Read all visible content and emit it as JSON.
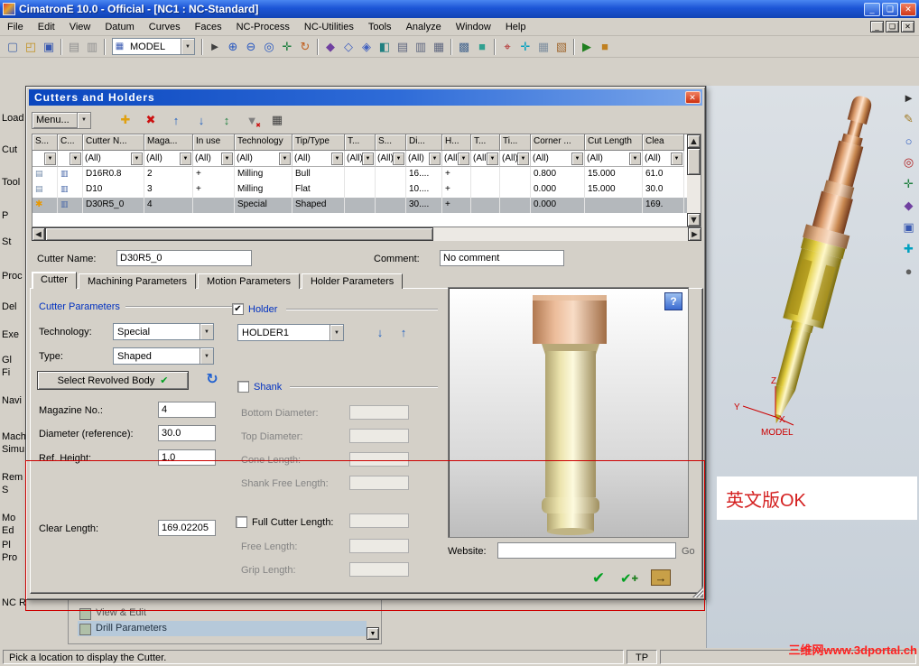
{
  "window": {
    "title": "CimatronE 10.0 - Official - [NC1 : NC-Standard]",
    "controls": {
      "minimize": "_",
      "restore": "❏",
      "close": "✕"
    }
  },
  "menu_bar": [
    "File",
    "Edit",
    "View",
    "Datum",
    "Curves",
    "Faces",
    "NC-Process",
    "NC-Utilities",
    "Tools",
    "Analyze",
    "Window",
    "Help"
  ],
  "mdi_controls": {
    "minimize": "_",
    "restore": "❏",
    "close": "✕"
  },
  "main_toolbar": {
    "model_selector": "MODEL",
    "icons_left": [
      {
        "name": "new-file-icon",
        "glyph": "▢",
        "color": "#4868a8"
      },
      {
        "name": "open-file-icon",
        "glyph": "◰",
        "color": "#c09020"
      },
      {
        "name": "save-icon",
        "glyph": "▣",
        "color": "#3858b0"
      },
      {
        "sep": true
      },
      {
        "name": "print-icon",
        "glyph": "▤",
        "color": "#909090"
      },
      {
        "name": "print-preview-icon",
        "glyph": "▥",
        "color": "#909090"
      },
      {
        "sep": true
      }
    ],
    "icons_right": [
      {
        "sep": true
      },
      {
        "name": "select-icon",
        "glyph": "►",
        "color": "#404040"
      },
      {
        "name": "zoom-in-icon",
        "glyph": "⊕",
        "color": "#2858c0"
      },
      {
        "name": "zoom-out-icon",
        "glyph": "⊖",
        "color": "#2858c0"
      },
      {
        "name": "zoom-fit-icon",
        "glyph": "◎",
        "color": "#2858c0"
      },
      {
        "name": "pan-icon",
        "glyph": "✛",
        "color": "#208040"
      },
      {
        "name": "rotate-view-icon",
        "glyph": "↻",
        "color": "#c06020"
      },
      {
        "sep": true
      },
      {
        "name": "shaded-view-icon",
        "glyph": "◆",
        "color": "#7040a0"
      },
      {
        "name": "wireframe-view-icon",
        "glyph": "◇",
        "color": "#4060c0"
      },
      {
        "name": "hidden-line-icon",
        "glyph": "◈",
        "color": "#4060c0"
      },
      {
        "name": "iso-view-icon",
        "glyph": "◧",
        "color": "#208080"
      },
      {
        "name": "top-view-icon",
        "glyph": "▤",
        "color": "#606880"
      },
      {
        "name": "front-view-icon",
        "glyph": "▥",
        "color": "#606880"
      },
      {
        "name": "right-view-icon",
        "glyph": "▦",
        "color": "#606880"
      },
      {
        "sep": true
      },
      {
        "name": "display-mode-icon",
        "glyph": "▩",
        "color": "#486890"
      },
      {
        "name": "render-icon",
        "glyph": "■",
        "color": "#30a090"
      },
      {
        "sep": true
      },
      {
        "name": "measure-icon",
        "glyph": "⌖",
        "color": "#b02020"
      },
      {
        "name": "ucs-icon",
        "glyph": "✛",
        "color": "#00a0c0"
      },
      {
        "name": "grid-icon",
        "glyph": "▦",
        "color": "#8090a0"
      },
      {
        "name": "layers-icon",
        "glyph": "▧",
        "color": "#a06830"
      },
      {
        "sep": true
      },
      {
        "name": "simulate-icon",
        "glyph": "▶",
        "color": "#208020"
      },
      {
        "name": "stock-icon",
        "glyph": "■",
        "color": "#c08020"
      }
    ]
  },
  "secondary_toolbar": {
    "icons": [
      {
        "name": "datum-csys-icon",
        "glyph": "✛",
        "color": "#00a0c0"
      },
      {
        "name": "axis-icon",
        "glyph": "⌖",
        "color": "#b02020"
      },
      {
        "name": "plane-icon",
        "glyph": "◧",
        "color": "#4060c0"
      },
      {
        "name": "point-icon",
        "glyph": "●",
        "color": "#202020"
      },
      {
        "name": "corner-icon",
        "glyph": "∟",
        "color": "#208040"
      },
      {
        "name": "view-manager-icon",
        "glyph": "▦",
        "color": "#606880"
      },
      {
        "name": "snap-icon",
        "glyph": "◎",
        "color": "#a06830"
      }
    ]
  },
  "right_toolbar": {
    "icons": [
      {
        "name": "select-tool-icon",
        "glyph": "►",
        "color": "#303030"
      },
      {
        "name": "sketch-pencil-icon",
        "glyph": "✎",
        "color": "#a07820"
      },
      {
        "name": "circle-icon",
        "glyph": "○",
        "color": "#2858c0"
      },
      {
        "name": "target-icon",
        "glyph": "◎",
        "color": "#b02020"
      },
      {
        "name": "cross-icon",
        "glyph": "✛",
        "color": "#208040"
      },
      {
        "name": "diamond-icon",
        "glyph": "◆",
        "color": "#7040a0"
      },
      {
        "name": "solid-icon",
        "glyph": "▣",
        "color": "#3858b0"
      },
      {
        "name": "add-icon",
        "glyph": "✚",
        "color": "#00a0c0"
      },
      {
        "name": "dot-icon",
        "glyph": "●",
        "color": "#606060"
      }
    ]
  },
  "left_panel_labels": [
    "Load",
    "Cut",
    "Tool",
    "P",
    "St",
    "Proc",
    "Del",
    "Exe",
    "Gl",
    "Fi",
    "Navi",
    "Mach",
    "Simu",
    "Rem",
    "S",
    "Mo",
    "Ed",
    "Pl",
    "Pro",
    "NC Report"
  ],
  "dialog": {
    "title": "Cutters and Holders",
    "close_glyph": "✕",
    "menu_button": "Menu...",
    "toolbar_icons": [
      {
        "name": "add-cutter-icon",
        "glyph": "✚",
        "color": "#e0a010"
      },
      {
        "name": "delete-cutter-icon",
        "glyph": "✖",
        "color": "#cc1010"
      },
      {
        "name": "export-cutter-icon",
        "glyph": "↑",
        "color": "#2060c0"
      },
      {
        "name": "import-cutter-icon",
        "glyph": "↓",
        "color": "#2060c0"
      },
      {
        "name": "sync-cutter-icon",
        "glyph": "↕",
        "color": "#208040"
      },
      {
        "name": "clear-filter-icon",
        "glyph": "▼",
        "color": "#808080",
        "badge": "✖",
        "badge_color": "#cc1010"
      },
      {
        "name": "cutter-catalog-icon",
        "glyph": "▦",
        "color": "#404040"
      }
    ],
    "table": {
      "columns": [
        "S...",
        "C...",
        "Cutter N...",
        "Maga...",
        "In use",
        "Technology",
        "Tip/Type",
        "T...",
        "S...",
        "Di...",
        "H...",
        "T...",
        "Ti...",
        "Corner ...",
        "Cut Length",
        "Clea"
      ],
      "filters": [
        "",
        "",
        "(All)",
        "(All)",
        "(All)",
        "(All)",
        "(All)",
        "(All)",
        "(All)",
        "(All)",
        "(All)",
        "(All)",
        "(All)",
        "(All)",
        "(All)",
        "(All)"
      ],
      "rows": [
        {
          "current": false,
          "selected": false,
          "cells": [
            "",
            "",
            "D16R0.8",
            "2",
            "+",
            "Milling",
            "Bull",
            "",
            "",
            "16....",
            "+",
            "",
            "",
            "0.800",
            "15.000",
            "61.0"
          ]
        },
        {
          "current": false,
          "selected": false,
          "cells": [
            "",
            "",
            "D10",
            "3",
            "+",
            "Milling",
            "Flat",
            "",
            "",
            "10....",
            "+",
            "",
            "",
            "0.000",
            "15.000",
            "30.0"
          ]
        },
        {
          "current": true,
          "selected": true,
          "cells": [
            "",
            "",
            "D30R5_0",
            "4",
            "",
            "Special",
            "Shaped",
            "",
            "",
            "30....",
            "+",
            "",
            "",
            "0.000",
            "",
            "169."
          ]
        }
      ]
    },
    "tabs": [
      "Cutter",
      "Machining Parameters",
      "Motion Parameters",
      "Holder Parameters"
    ],
    "active_tab": 0,
    "form": {
      "cutter_name_label": "Cutter Name:",
      "cutter_name": "D30R5_0",
      "comment_label": "Comment:",
      "comment": "No comment",
      "cutter_parameters_title": "Cutter Parameters",
      "technology_label": "Technology:",
      "technology": "Special",
      "type_label": "Type:",
      "type": "Shaped",
      "select_revolved_body": "Select Revolved Body",
      "magazine_label": "Magazine No.:",
      "magazine": "4",
      "diameter_label": "Diameter (reference):",
      "diameter": "30.0",
      "ref_height_label": "Ref. Height:",
      "ref_height": "1.0",
      "clear_length_label": "Clear Length:",
      "clear_length": "169.02205",
      "holder_label": "Holder",
      "holder_checked": true,
      "holder_value": "HOLDER1",
      "shank_label": "Shank",
      "shank_checked": false,
      "bottom_diameter_label": "Bottom Diameter:",
      "top_diameter_label": "Top Diameter:",
      "cone_length_label": "Cone Length:",
      "shank_free_length_label": "Shank Free Length:",
      "full_cutter_length_label": "Full Cutter Length:",
      "full_cutter_length_checked": false,
      "free_length_label": "Free Length:",
      "grip_length_label": "Grip Length:",
      "website_label": "Website:",
      "website_value": "",
      "go_label": "Go"
    },
    "actions": {
      "ok_glyph": "✔",
      "apply_glyph": "✔",
      "apply_badge": "✚",
      "exit_glyph": "→",
      "help_glyph": "?",
      "refresh_glyph": "↻",
      "select_body_check": "✔"
    }
  },
  "background_window": {
    "items": [
      {
        "label": "View & Edit",
        "highlighted": false
      },
      {
        "label": "Drill Parameters",
        "highlighted": true
      }
    ]
  },
  "viewport": {
    "axes": {
      "x": "X",
      "y": "Y",
      "z": "Z"
    },
    "origin_label": "MODEL",
    "note": "英文版OK"
  },
  "status_bar": {
    "message": "Pick a location to display the Cutter.",
    "mode": "TP",
    "watermark": "三维网www.3dportal.ch"
  }
}
